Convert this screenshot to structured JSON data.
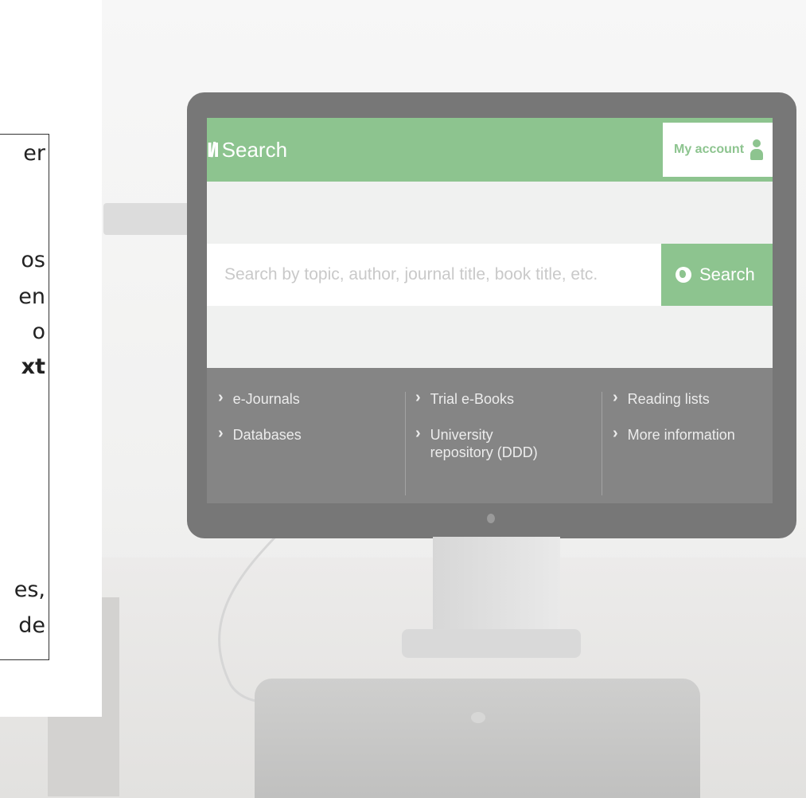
{
  "overlay_text": {
    "fragments": [
      "er",
      "os",
      "en",
      "o",
      "xt",
      "es,",
      "de"
    ]
  },
  "site": {
    "brand_mark": "I/I",
    "brand_name": "Search",
    "account_label": "My account",
    "search": {
      "placeholder": "Search by topic, author, journal title, book title, etc.",
      "button_label": "Search"
    },
    "links": {
      "col1": [
        "e-Journals",
        "Databases"
      ],
      "col2": [
        "Trial e-Books",
        "University repository (DDD)"
      ],
      "col3": [
        "Reading lists",
        "More information"
      ]
    }
  },
  "icons": {
    "account": "user-icon",
    "search_button": "globe-icon",
    "link": "chevron-right-icon"
  },
  "colors": {
    "accent": "#8dc48f",
    "link_panel": "#858585",
    "monitor_bezel": "#777777"
  }
}
